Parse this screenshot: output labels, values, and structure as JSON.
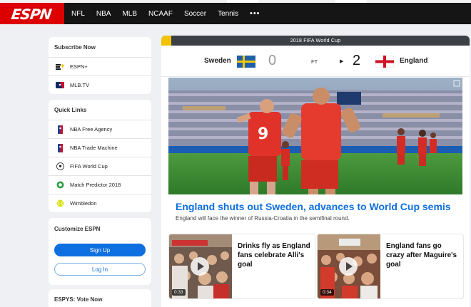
{
  "nav": {
    "logo": "ESPN",
    "items": [
      "NFL",
      "NBA",
      "MLB",
      "NCAAF",
      "Soccer",
      "Tennis"
    ],
    "more": "•••"
  },
  "subscribe": {
    "title": "Subscribe Now",
    "items": [
      {
        "label": "ESPN+",
        "icon": "espn-plus-icon"
      },
      {
        "label": "MLB.TV",
        "icon": "mlb-icon"
      }
    ]
  },
  "quick_links": {
    "title": "Quick Links",
    "items": [
      {
        "label": "NBA Free Agency",
        "icon": "nba-icon"
      },
      {
        "label": "NBA Trade Machine",
        "icon": "nba-icon"
      },
      {
        "label": "FIFA World Cup",
        "icon": "soccer-ball-icon"
      },
      {
        "label": "Match Predictor 2018",
        "icon": "soccer-ball-icon"
      },
      {
        "label": "Wimbledon",
        "icon": "tennis-ball-icon"
      }
    ]
  },
  "customize": {
    "title": "Customize ESPN",
    "signup": "Sign Up",
    "login": "Log In"
  },
  "espys": {
    "title": "ESPYS: Vote Now"
  },
  "match": {
    "banner": "2018 FIFA World Cup",
    "home_team": "Sweden",
    "home_score": "0",
    "status": "FT",
    "away_score": "2",
    "away_team": "England"
  },
  "lead_story": {
    "headline": "England shuts out Sweden, advances to World Cup semis",
    "summary": "England will face the winner of Russia-Croatia in the semifinal round."
  },
  "stories": [
    {
      "title": "Drinks fly as England fans celebrate Alli's goal",
      "duration": "0:33"
    },
    {
      "title": "England fans go crazy after Maguire's goal",
      "duration": "0:34"
    }
  ],
  "colors": {
    "espn_red": "#dd0000",
    "link_blue": "#0e6fe0",
    "nav_bg": "#151515"
  }
}
